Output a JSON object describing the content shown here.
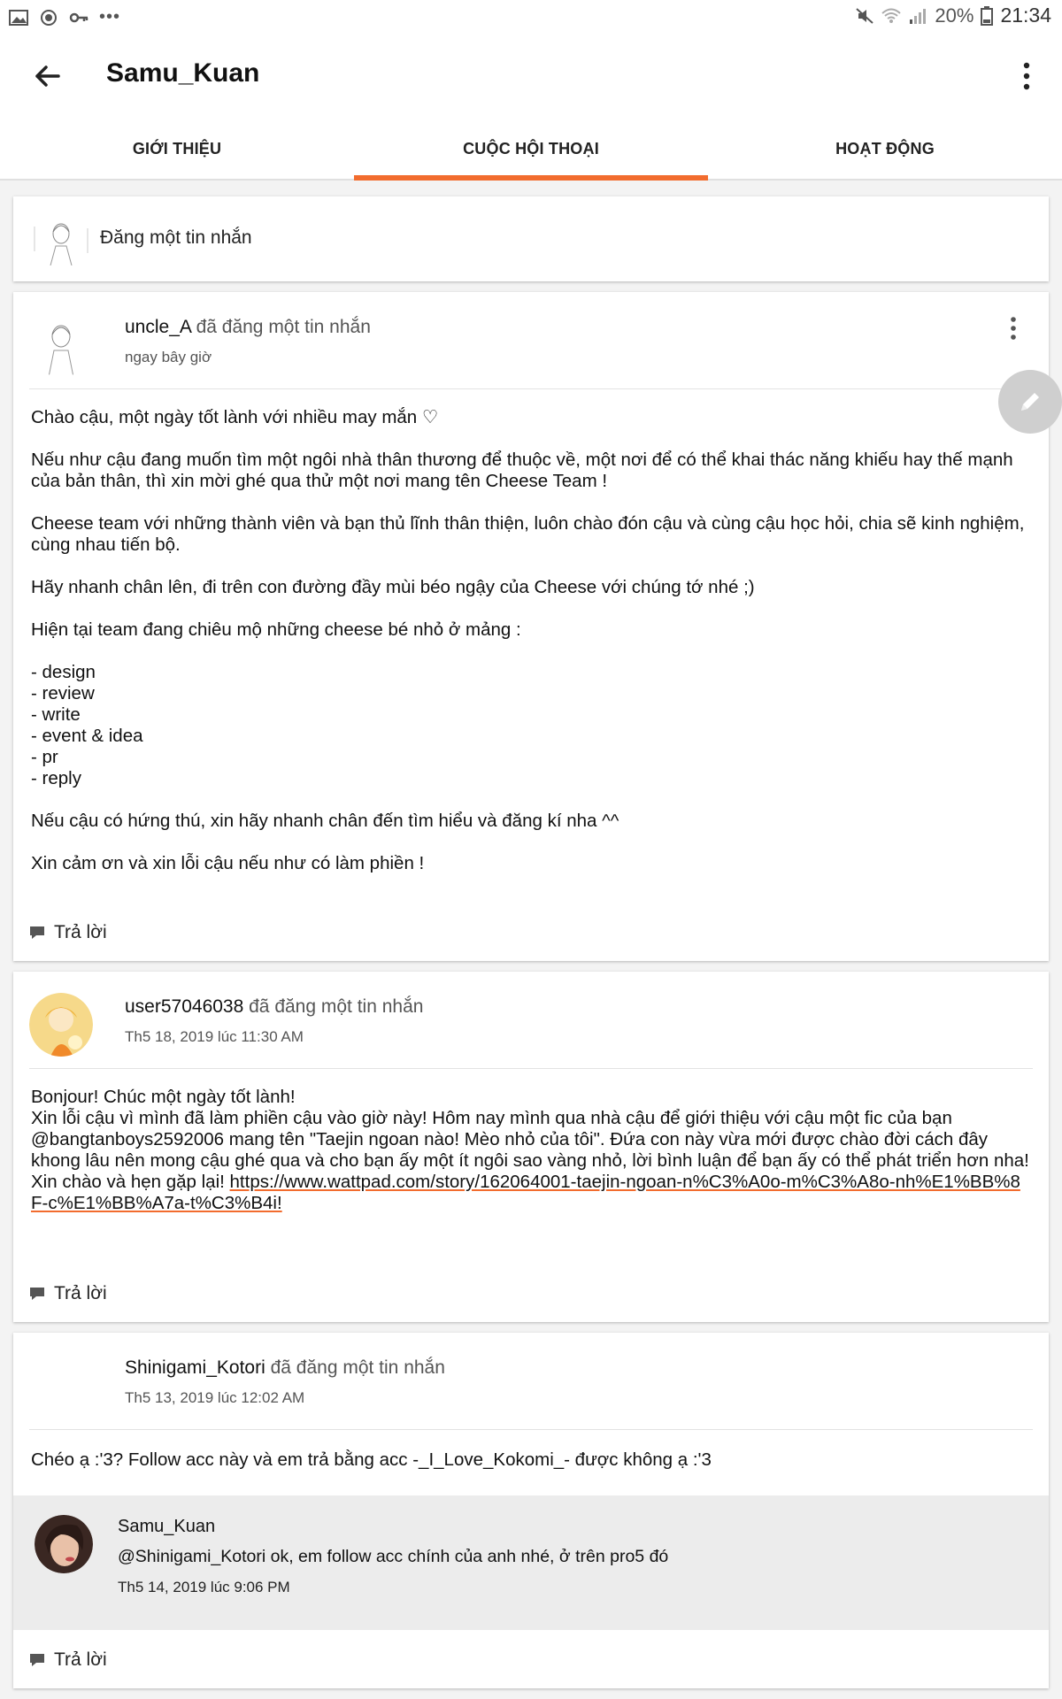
{
  "status_bar": {
    "battery": "20%",
    "time": "21:34",
    "left_icons": [
      "image-icon",
      "vpn-icon",
      "key-icon",
      "more-dots-icon"
    ],
    "right_icons": [
      "mute-icon",
      "wifi-icon",
      "signal-icon",
      "battery-icon"
    ]
  },
  "header": {
    "title": "Samu_Kuan"
  },
  "tabs": [
    {
      "label": "GIỚI THIỆU",
      "active": false
    },
    {
      "label": "CUỘC HỘI THOẠI",
      "active": true
    },
    {
      "label": "HOẠT ĐỘNG",
      "active": false
    }
  ],
  "compose": {
    "placeholder": "Đăng một tin nhắn"
  },
  "posts": [
    {
      "user": "uncle_A",
      "action": " đã đăng một tin nhắn",
      "time": "ngay bây giờ",
      "paragraphs": [
        "Chào cậu, một ngày tốt lành với nhiều may mắn ♡",
        "Nếu như cậu đang muốn tìm một ngôi nhà thân thương để thuộc về, một nơi để có thể khai thác năng khiếu hay thế mạnh của bản thân, thì xin mời ghé qua thử một nơi mang tên Cheese Team !",
        "Cheese team với những thành viên và bạn thủ lĩnh thân thiện, luôn chào đón cậu và cùng cậu học hỏi, chia sẽ kinh nghiệm, cùng nhau tiến bộ.",
        "Hãy nhanh chân lên, đi trên con đường đầy mùi béo ngậy của Cheese với chúng tớ nhé ;)",
        "Hiện tại team đang chiêu mộ những cheese bé nhỏ ở mảng :",
        "- design\n- review\n- write\n- event & idea\n- pr\n- reply",
        "Nếu cậu có hứng thú, xin hãy nhanh chân đến tìm hiểu và đăng kí nha ^^",
        "Xin cảm ơn và xin lỗi cậu nếu như có làm phiền !"
      ],
      "reply_label": "Trả lời"
    },
    {
      "user": "user57046038",
      "action": " đã đăng một tin nhắn",
      "time": "Th5 18, 2019 lúc 11:30 AM",
      "line1": "Bonjour! Chúc một ngày tốt lành!",
      "line2": "Xin lỗi cậu vì mình đã làm phiền cậu vào giờ này! Hôm nay mình qua nhà cậu để giới thiệu với cậu một fic của bạn @bangtanboys2592006 mang tên \"Taejin ngoan nào! Mèo nhỏ của tôi\". Đứa con này vừa mới được chào đời cách đây khong lâu nên mong cậu ghé qua và cho bạn ấy một ít ngôi sao vàng nhỏ, lời bình luận để bạn ấy có thể phát triển hơn nha!",
      "line3_prefix": "Xin chào và hẹn gặp lại! ",
      "link": "https://www.wattpad.com/story/162064001-taejin-ngoan-n%C3%A0o-m%C3%A8o-nh%E1%BB%8F-c%E1%BB%A7a-t%C3%B4i!",
      "reply_label": "Trả lời"
    },
    {
      "user": "Shinigami_Kotori",
      "action": " đã đăng một tin nhắn",
      "time": "Th5 13, 2019 lúc 12:02 AM",
      "text": "Chéo ạ :'3? Follow acc này và em trả bằng acc -_I_Love_Kokomi_- được không ạ :'3",
      "reply": {
        "user": "Samu_Kuan",
        "text": "@Shinigami_Kotori  ok, em follow acc chính của anh nhé, ở trên pro5 đó",
        "time": "Th5 14, 2019 lúc 9:06 PM"
      },
      "reply_label": "Trả lời"
    }
  ],
  "colors": {
    "accent": "#f26c2e",
    "background": "#f3f3f3",
    "fab": "#cfcfcf"
  }
}
